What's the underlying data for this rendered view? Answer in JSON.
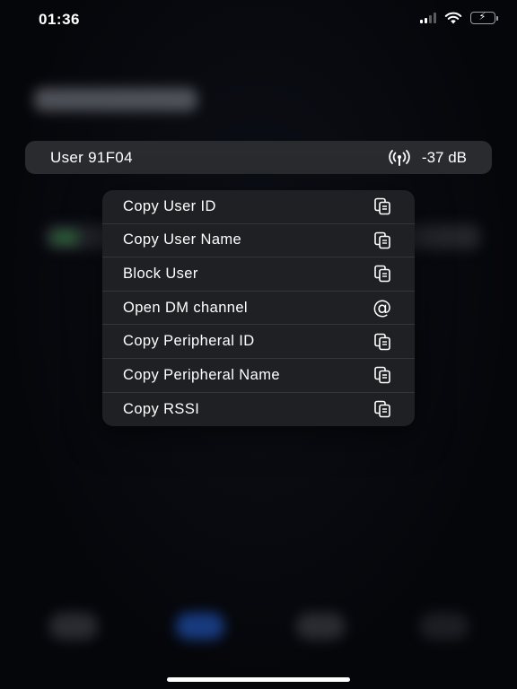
{
  "status_bar": {
    "time": "01:36",
    "icons": [
      "cellular-signal-icon",
      "wifi-icon",
      "battery-charging-icon"
    ]
  },
  "peer": {
    "name": "User 91F04",
    "rssi": "-37 dB",
    "icon": "antenna-icon"
  },
  "menu": {
    "items": [
      {
        "label": "Copy User ID",
        "icon": "copy-icon"
      },
      {
        "label": "Copy User Name",
        "icon": "copy-icon"
      },
      {
        "label": "Block User",
        "icon": "copy-icon"
      },
      {
        "label": "Open DM channel",
        "icon": "at-icon"
      },
      {
        "label": "Copy Peripheral ID",
        "icon": "copy-icon"
      },
      {
        "label": "Copy Peripheral Name",
        "icon": "copy-icon"
      },
      {
        "label": "Copy RSSI",
        "icon": "copy-icon"
      }
    ]
  },
  "colors": {
    "background": "#05060a",
    "menu_background": "#1f2024",
    "row_background": "#2a2b2f",
    "battery": "#34c759"
  }
}
